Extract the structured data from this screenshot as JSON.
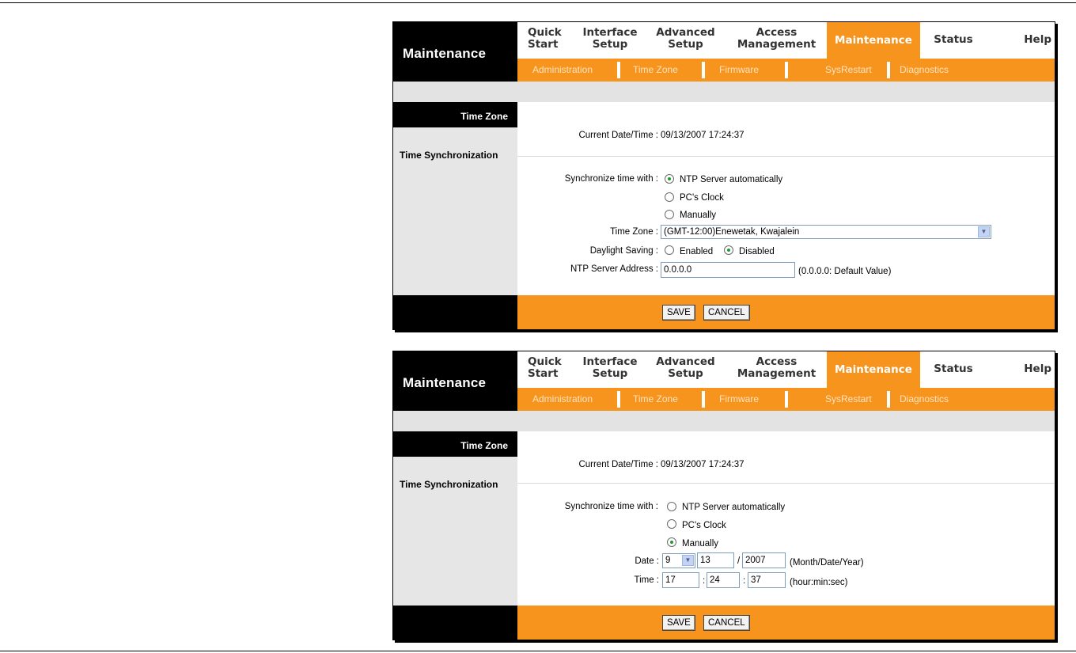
{
  "brand": "Maintenance",
  "nav": [
    {
      "line1": "Quick",
      "line2": "Start"
    },
    {
      "line1": "Interface",
      "line2": "Setup"
    },
    {
      "line1": "Advanced",
      "line2": "Setup"
    },
    {
      "line1": "Access",
      "line2": "Management"
    },
    {
      "line1": "Maintenance",
      "line2": ""
    },
    {
      "line1": "Status",
      "line2": ""
    },
    {
      "line1": "Help",
      "line2": ""
    }
  ],
  "subnav": [
    "Administration",
    "Time Zone",
    "Firmware",
    "SysRestart",
    "Diagnostics"
  ],
  "section_title": "Time Zone",
  "section_subtitle": "Time Synchronization",
  "current_datetime_label": "Current Date/Time :",
  "current_datetime_value": "09/13/2007 17:24:37",
  "sync_label": "Synchronize time with :",
  "sync_options": [
    "NTP Server automatically",
    "PC's Clock",
    "Manually"
  ],
  "panel1": {
    "selected_sync": "NTP Server automatically",
    "timezone_label": "Time Zone :",
    "timezone_value": "(GMT-12:00)Enewetak, Kwajalein",
    "daylight_label": "Daylight Saving :",
    "daylight_options": [
      "Enabled",
      "Disabled"
    ],
    "daylight_selected": "Disabled",
    "ntp_label": "NTP Server Address :",
    "ntp_value": "0.0.0.0",
    "ntp_hint": "(0.0.0.0: Default Value)"
  },
  "panel2": {
    "selected_sync": "Manually",
    "date_label": "Date :",
    "month_value": "9",
    "day_value": "13",
    "date_sep": "/",
    "year_value": "2007",
    "date_hint": "(Month/Date/Year)",
    "time_label": "Time :",
    "hour_value": "17",
    "min_value": "24",
    "sec_value": "37",
    "time_sep": ":",
    "time_hint": "(hour:min:sec)"
  },
  "buttons": {
    "save": "SAVE",
    "cancel": "CANCEL"
  },
  "colors": {
    "accent": "#f7941d",
    "header": "#000000",
    "side": "#e6e6e6"
  },
  "icons": {
    "dropdown": "chevron-down-icon",
    "radio": "radio-icon"
  }
}
